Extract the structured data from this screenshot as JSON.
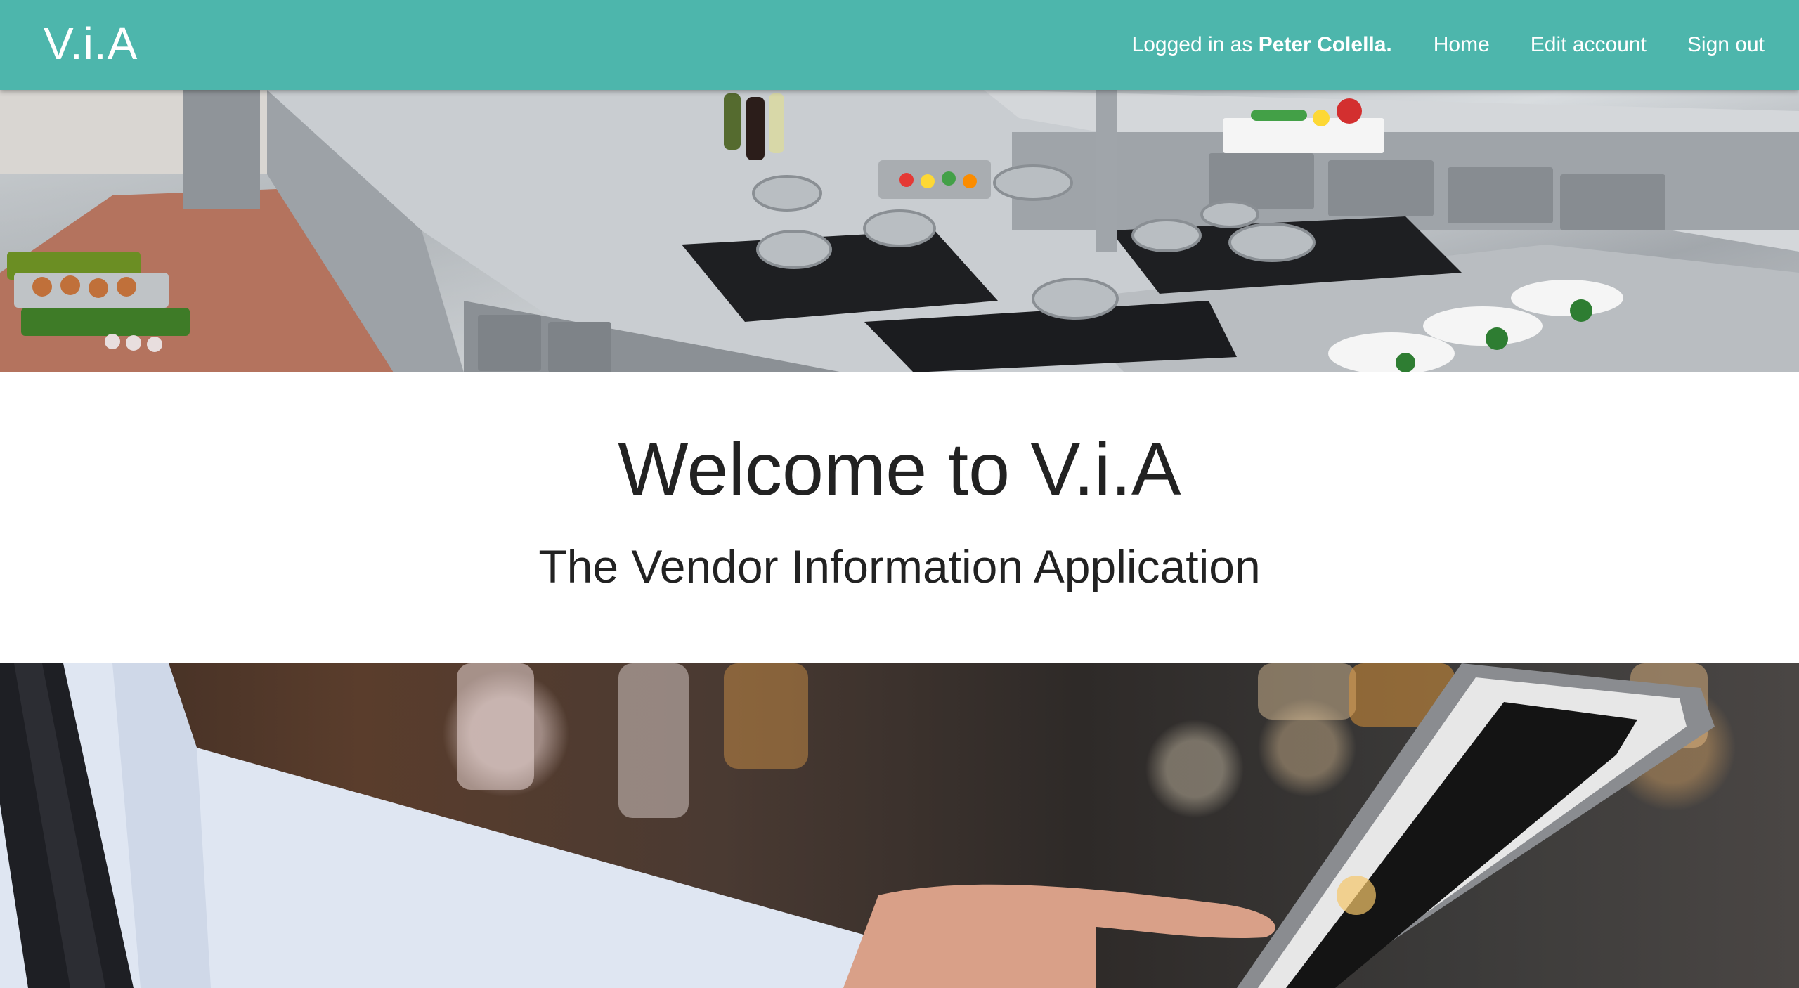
{
  "navbar": {
    "brand": "V.i.A",
    "logged_in_prefix": "Logged in as",
    "user_name": "Peter Colella.",
    "links": [
      {
        "label": "Home"
      },
      {
        "label": "Edit account"
      },
      {
        "label": "Sign out"
      }
    ],
    "background_color": "#4db6ac"
  },
  "hero_top": {
    "description": "commercial kitchen photo"
  },
  "welcome": {
    "title": "Welcome to V.i.A",
    "subtitle": "The Vendor Information Application"
  },
  "hero_bottom": {
    "description": "person using tablet photo"
  }
}
